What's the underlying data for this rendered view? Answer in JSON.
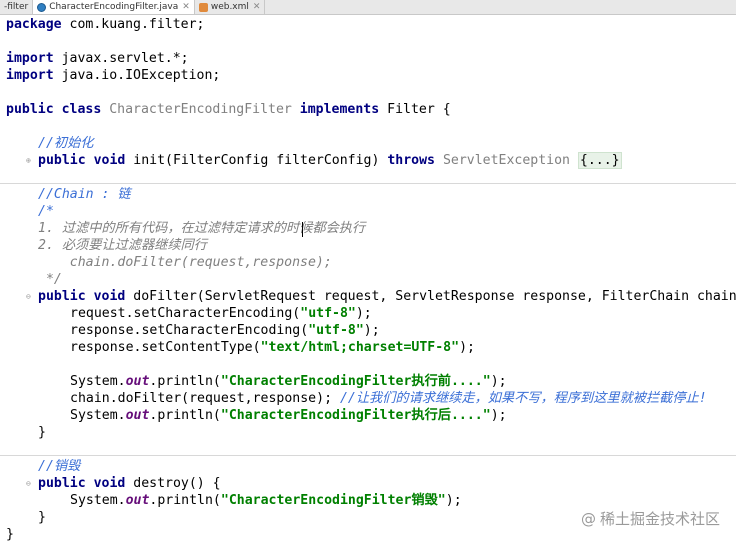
{
  "tabs": [
    {
      "label": "-filter",
      "icon": "module-icon"
    },
    {
      "label": "CharacterEncodingFilter.java",
      "icon": "java-class-icon",
      "active": true
    },
    {
      "label": "web.xml",
      "icon": "xml-file-icon"
    }
  ],
  "code": {
    "pkg_kw": "package",
    "pkg_name": " com.kuang.filter;",
    "imp1_kw": "import",
    "imp1_name": " javax.servlet.*;",
    "imp2_kw": "import",
    "imp2_name": " java.io.IOException;",
    "cls_kw": "public class",
    "cls_name": " CharacterEncodingFilter ",
    "cls_impl": "implements",
    "cls_rest": " Filter {",
    "init_comment": "//初始化",
    "init_kw": "public void",
    "init_sig": " init(FilterConfig filterConfig) ",
    "init_throws": "throws",
    "init_exc": " ServletException ",
    "init_fold": "{...}",
    "chain_comment": "//Chain : 链",
    "doc_open": "/*",
    "doc_1a": "1. 过滤中的所有代码，在过滤特定请求的",
    "doc_1b": "时候都会执行",
    "doc_2": "2. 必须要让过滤器继续同行",
    "doc_3": "    chain.doFilter(request,response);",
    "doc_close": " */",
    "do_kw": "public void",
    "do_sig": " doFilter(ServletRequest request, ServletResponse response, FilterChain chain)",
    "l1_a": "request.setCharacterEncoding(",
    "l1_s": "\"utf-8\"",
    "l1_b": ");",
    "l2_a": "response.setCharacterEncoding(",
    "l2_s": "\"utf-8\"",
    "l2_b": ");",
    "l3_a": "response.setContentType(",
    "l3_s": "\"text/html;charset=UTF-8\"",
    "l3_b": ");",
    "p1_a": "System.",
    "p1_out": "out",
    "p1_b": ".println(",
    "p1_s": "\"CharacterEncodingFilter执行前....\"",
    "p1_c": ");",
    "ch_a": "chain.doFilter(request,response); ",
    "ch_cm": "//让我们的请求继续走，如果不写，程序到这里就被拦截停止!",
    "p2_a": "System.",
    "p2_out": "out",
    "p2_b": ".println(",
    "p2_s": "\"CharacterEncodingFilter执行后....\"",
    "p2_c": ");",
    "close1": "}",
    "destroy_comment": "//销毁",
    "de_kw": "public void",
    "de_sig": " destroy() {",
    "p3_a": "System.",
    "p3_out": "out",
    "p3_b": ".println(",
    "p3_s": "\"CharacterEncodingFilter销毁\"",
    "p3_c": ");",
    "close2": "}",
    "close3": "}"
  },
  "watermark": {
    "at": "@",
    "text": "稀土掘金技术社区"
  },
  "colors": {
    "keyword": "#000080",
    "string": "#008000",
    "comment": "#3b6fd6",
    "doc_gray": "#808080"
  }
}
